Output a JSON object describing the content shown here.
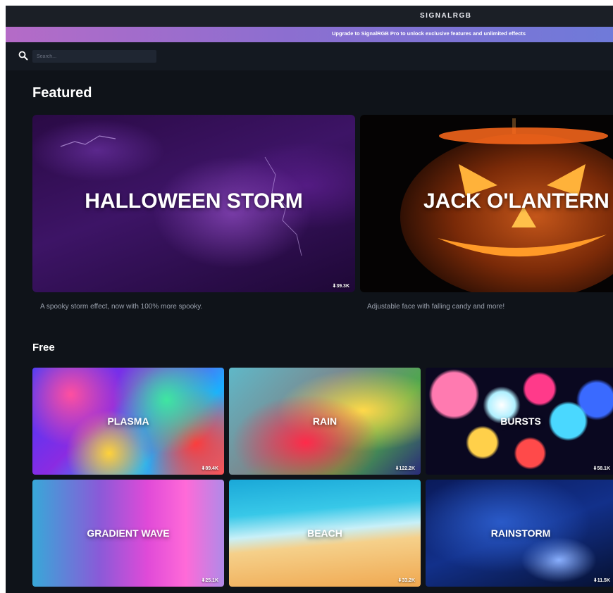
{
  "app": {
    "brand": "SIGNALRGB",
    "promo": "Upgrade to SignalRGB Pro to unlock exclusive features and unlimited effects"
  },
  "search": {
    "placeholder": "Search..."
  },
  "featured": {
    "title": "Featured",
    "cards": [
      {
        "label": "HALLOWEEN STORM",
        "description": "A spooky storm effect, now with 100% more spooky.",
        "downloads": "⬇39.3K"
      },
      {
        "label": "JACK O'LANTERN",
        "description": "Adjustable face with falling candy and more!",
        "downloads": ""
      }
    ]
  },
  "free": {
    "title": "Free",
    "tiles": [
      {
        "label": "PLASMA",
        "downloads": "⬇89.4K"
      },
      {
        "label": "RAIN",
        "downloads": "⬇122.2K"
      },
      {
        "label": "BURSTS",
        "downloads": "⬇58.1K"
      },
      {
        "label": "GRADIENT WAVE",
        "downloads": "⬇25.1K"
      },
      {
        "label": "BEACH",
        "downloads": "⬇33.2K"
      },
      {
        "label": "RAINSTORM",
        "downloads": "⬇11.5K"
      }
    ]
  },
  "icons": {
    "search": "search-icon",
    "download": "download-arrow-icon"
  },
  "colors": {
    "app_background": "#0f1319",
    "titlebar": "#1b1f26",
    "promo_gradient_start": "#b56bc7",
    "promo_gradient_end": "#6f7ad9",
    "description_text": "#9aa1ad"
  }
}
